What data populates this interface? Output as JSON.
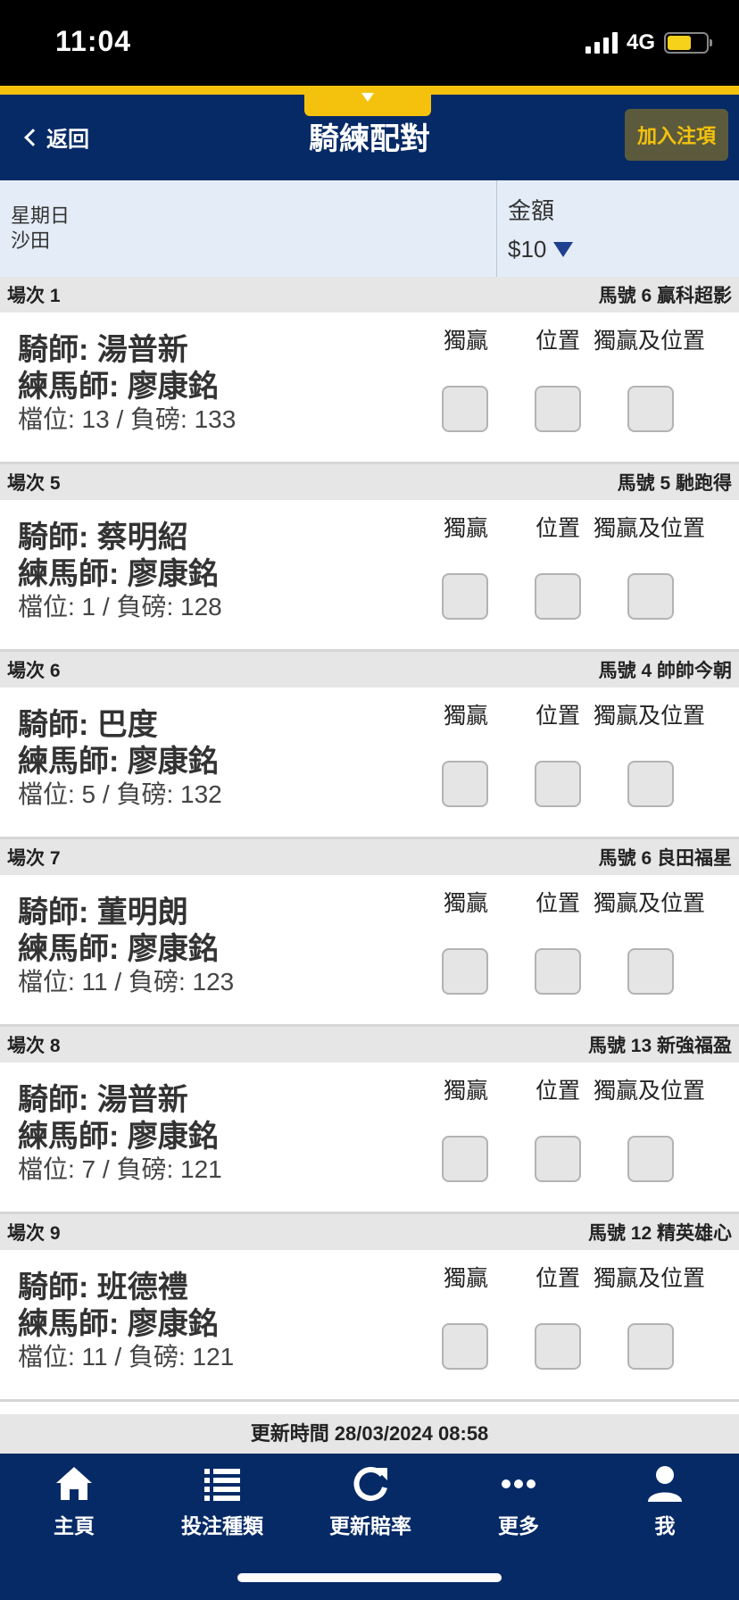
{
  "status": {
    "time": "11:04",
    "network": "4G"
  },
  "header": {
    "back_label": "返回",
    "title": "騎練配對",
    "add_button": "加入注項"
  },
  "info": {
    "day": "星期日",
    "venue": "沙田",
    "amount_label": "金額",
    "amount_value": "$10"
  },
  "columns": {
    "win": "獨贏",
    "place": "位置",
    "win_place": "獨贏及位置"
  },
  "races": [
    {
      "race": "場次 1",
      "horse": "馬號 6 贏科超影",
      "jockey": "騎師: 湯普新",
      "trainer": "練馬師: 廖康銘",
      "draw_weight": "檔位: 13 / 負磅: 133"
    },
    {
      "race": "場次 5",
      "horse": "馬號 5 馳跑得",
      "jockey": "騎師: 蔡明紹",
      "trainer": "練馬師: 廖康銘",
      "draw_weight": "檔位: 1 / 負磅: 128"
    },
    {
      "race": "場次 6",
      "horse": "馬號 4 帥帥今朝",
      "jockey": "騎師: 巴度",
      "trainer": "練馬師: 廖康銘",
      "draw_weight": "檔位: 5 / 負磅: 132"
    },
    {
      "race": "場次 7",
      "horse": "馬號 6 良田福星",
      "jockey": "騎師: 董明朗",
      "trainer": "練馬師: 廖康銘",
      "draw_weight": "檔位: 11 / 負磅: 123"
    },
    {
      "race": "場次 8",
      "horse": "馬號 13 新強福盈",
      "jockey": "騎師: 湯普新",
      "trainer": "練馬師: 廖康銘",
      "draw_weight": "檔位: 7 / 負磅: 121"
    },
    {
      "race": "場次 9",
      "horse": "馬號 12 精英雄心",
      "jockey": "騎師: 班德禮",
      "trainer": "練馬師: 廖康銘",
      "draw_weight": "檔位: 11 / 負磅: 121"
    }
  ],
  "update_time": "更新時間 28/03/2024 08:58",
  "nav": [
    {
      "label": "主頁",
      "icon": "home-icon"
    },
    {
      "label": "投注種類",
      "icon": "list-icon"
    },
    {
      "label": "更新賠率",
      "icon": "refresh-icon"
    },
    {
      "label": "更多",
      "icon": "more-icon"
    },
    {
      "label": "我",
      "icon": "profile-icon"
    }
  ],
  "colors": {
    "navy": "#062a66",
    "gold": "#f4c20d",
    "panel": "#e3ecf7"
  }
}
